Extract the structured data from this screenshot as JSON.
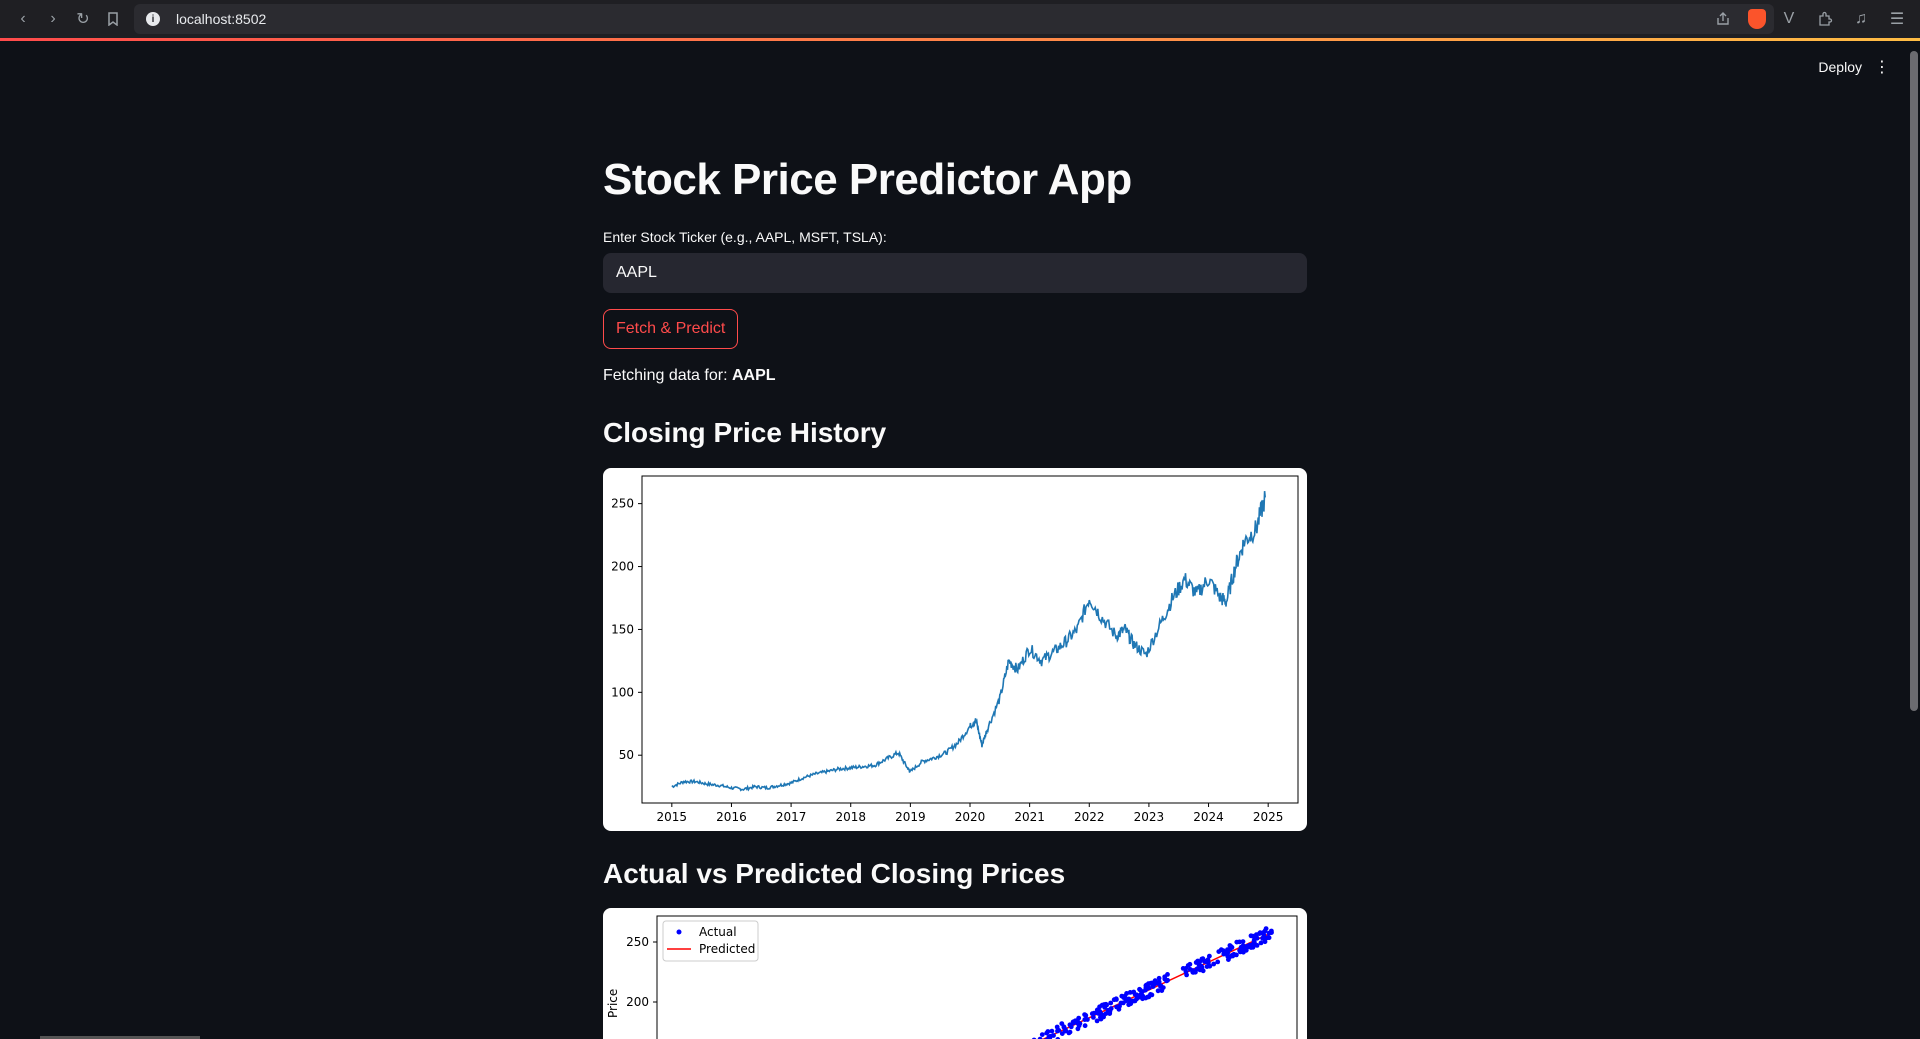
{
  "browser": {
    "url": "localhost:8502"
  },
  "header": {
    "deploy_label": "Deploy"
  },
  "app": {
    "title": "Stock Price Predictor App",
    "ticker_label": "Enter Stock Ticker (e.g., AAPL, MSFT, TSLA):",
    "ticker_value": "AAPL",
    "button_label": "Fetch & Predict",
    "status_prefix": "Fetching data for: ",
    "status_ticker": "AAPL",
    "section1_title": "Closing Price History",
    "section2_title": "Actual vs Predicted Closing Prices"
  },
  "chart_data": [
    {
      "type": "line",
      "title": "",
      "xlabel": "",
      "ylabel": "",
      "x_ticks": [
        "2015",
        "2016",
        "2017",
        "2018",
        "2019",
        "2020",
        "2021",
        "2022",
        "2023",
        "2024",
        "2025"
      ],
      "y_ticks": [
        50,
        100,
        150,
        200,
        250
      ],
      "xlim": [
        2014.5,
        2025.5
      ],
      "ylim": [
        12,
        272
      ],
      "grid": false,
      "color": "#1f77b4",
      "series": [
        {
          "x": [
            2015.0,
            2015.2,
            2015.4,
            2015.6,
            2015.8,
            2016.0,
            2016.2,
            2016.4,
            2016.6,
            2016.8,
            2017.0,
            2017.2,
            2017.4,
            2017.6,
            2017.8,
            2018.0,
            2018.2,
            2018.4,
            2018.6,
            2018.8,
            2018.95,
            2019.0,
            2019.2,
            2019.4,
            2019.6,
            2019.8,
            2020.0,
            2020.1,
            2020.2,
            2020.3,
            2020.5,
            2020.65,
            2020.8,
            2021.0,
            2021.2,
            2021.4,
            2021.6,
            2021.8,
            2022.0,
            2022.2,
            2022.45,
            2022.6,
            2022.75,
            2022.95,
            2023.2,
            2023.4,
            2023.6,
            2023.8,
            2024.0,
            2024.2,
            2024.3,
            2024.45,
            2024.6,
            2024.8,
            2024.95
          ],
          "y": [
            25,
            29,
            29,
            27,
            26,
            24,
            23,
            25,
            24,
            26,
            28,
            32,
            35,
            37,
            39,
            40,
            41,
            42,
            47,
            52,
            40,
            37,
            45,
            48,
            52,
            60,
            73,
            78,
            58,
            72,
            95,
            125,
            118,
            135,
            125,
            132,
            140,
            150,
            175,
            160,
            145,
            150,
            138,
            130,
            155,
            175,
            190,
            178,
            190,
            175,
            172,
            200,
            220,
            230,
            255
          ]
        }
      ]
    },
    {
      "type": "scatter",
      "title": "",
      "xlabel": "",
      "ylabel": "Price",
      "y_ticks": [
        200,
        250
      ],
      "legend": {
        "position": "top-left",
        "entries": [
          "Actual",
          "Predicted"
        ]
      },
      "series": [
        {
          "name": "Actual",
          "marker": "dot",
          "color": "#0000ff"
        },
        {
          "name": "Predicted",
          "marker": "line",
          "color": "#ff0000"
        }
      ]
    }
  ]
}
